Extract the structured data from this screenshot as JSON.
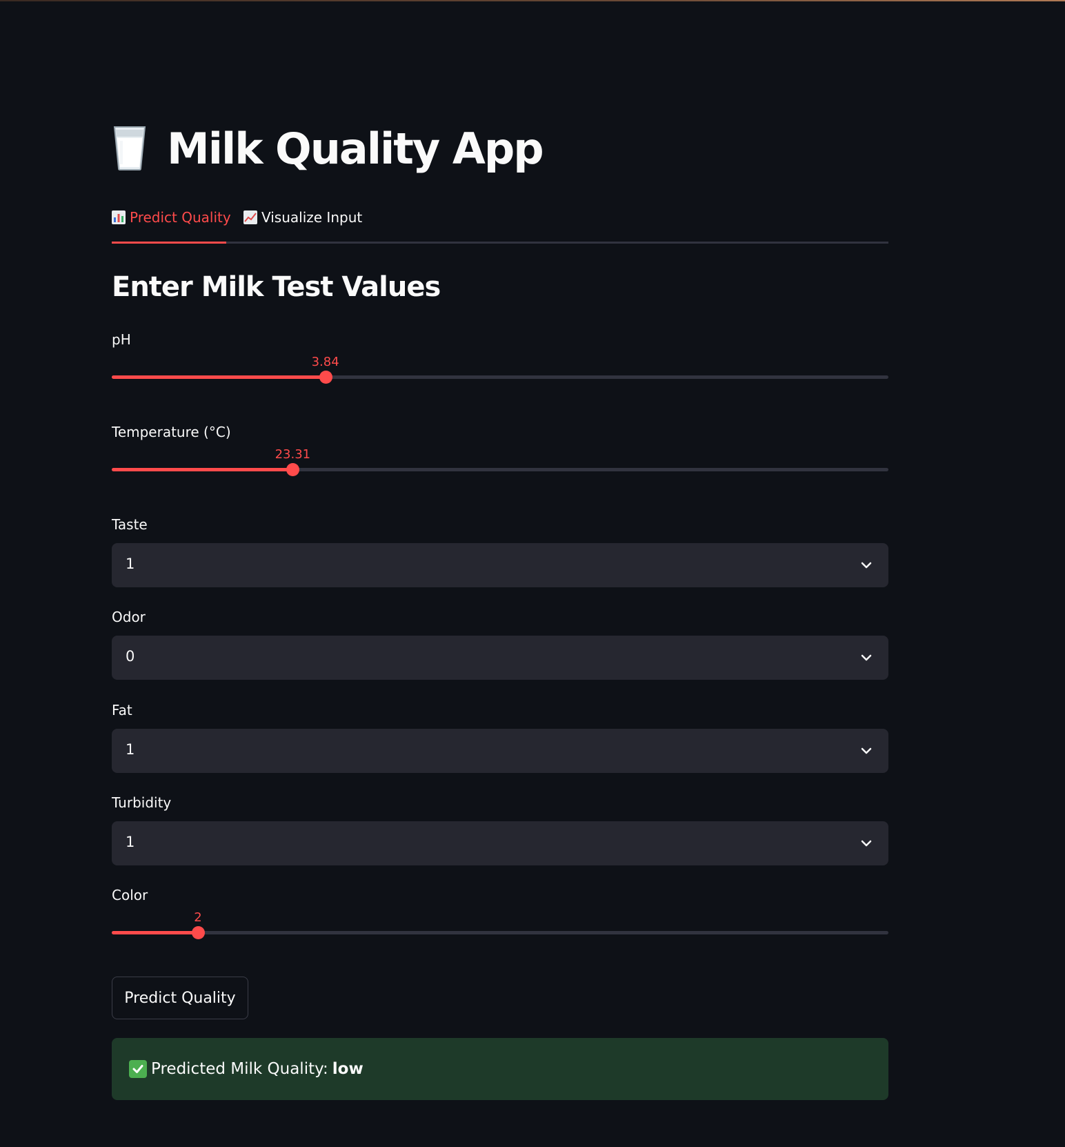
{
  "app": {
    "icon": "glass-of-milk-icon",
    "title": "Milk Quality App"
  },
  "tabs": [
    {
      "icon": "bar-chart-icon",
      "label": "Predict Quality",
      "active": true
    },
    {
      "icon": "line-chart-icon",
      "label": "Visualize Input",
      "active": false
    }
  ],
  "section": {
    "heading": "Enter Milk Test Values"
  },
  "fields": {
    "ph": {
      "label": "pH",
      "value": "3.84",
      "fraction": 0.275
    },
    "temperature": {
      "label": "Temperature (°C)",
      "value": "23.31",
      "fraction": 0.233
    },
    "taste": {
      "label": "Taste",
      "value": "1"
    },
    "odor": {
      "label": "Odor",
      "value": "0"
    },
    "fat": {
      "label": "Fat",
      "value": "1"
    },
    "turbidity": {
      "label": "Turbidity",
      "value": "1"
    },
    "color": {
      "label": "Color",
      "value": "2",
      "fraction": 0.111
    }
  },
  "button": {
    "label": "Predict Quality"
  },
  "result": {
    "icon": "check-mark-icon",
    "text": "Predicted Milk Quality:",
    "value": "low"
  },
  "colors": {
    "background": "#0e1117",
    "accent": "#ff4b4b",
    "track": "#31333f",
    "input_bg": "#262730",
    "success_bg": "#1e3a29"
  }
}
